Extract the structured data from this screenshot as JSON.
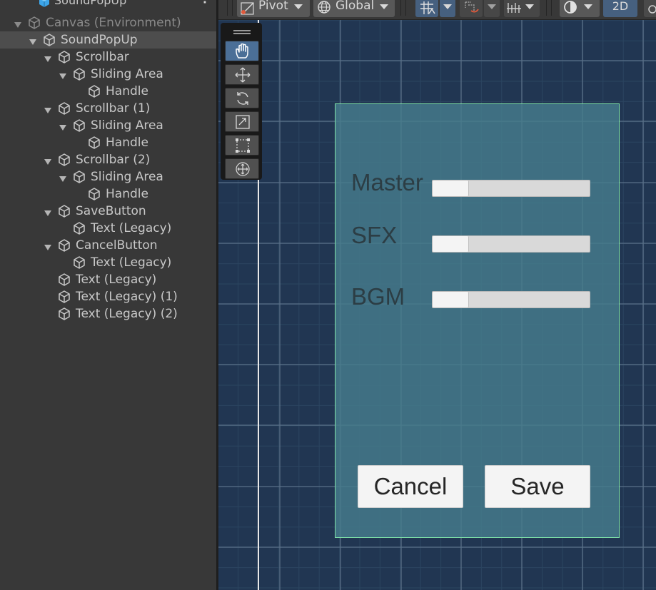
{
  "hierarchy": {
    "title": "SoundPopUp",
    "items": [
      {
        "label": "Canvas (Environment)",
        "depth": 0,
        "expanded": true,
        "dim": true
      },
      {
        "label": "SoundPopUp",
        "depth": 1,
        "expanded": true,
        "selected": true
      },
      {
        "label": "Scrollbar",
        "depth": 2,
        "expanded": true
      },
      {
        "label": "Sliding Area",
        "depth": 3,
        "expanded": true
      },
      {
        "label": "Handle",
        "depth": 4
      },
      {
        "label": "Scrollbar (1)",
        "depth": 2,
        "expanded": true
      },
      {
        "label": "Sliding Area",
        "depth": 3,
        "expanded": true
      },
      {
        "label": "Handle",
        "depth": 4
      },
      {
        "label": "Scrollbar (2)",
        "depth": 2,
        "expanded": true
      },
      {
        "label": "Sliding Area",
        "depth": 3,
        "expanded": true
      },
      {
        "label": "Handle",
        "depth": 4
      },
      {
        "label": "SaveButton",
        "depth": 2,
        "expanded": true
      },
      {
        "label": "Text (Legacy)",
        "depth": 3
      },
      {
        "label": "CancelButton",
        "depth": 2,
        "expanded": true
      },
      {
        "label": "Text (Legacy)",
        "depth": 3
      },
      {
        "label": "Text (Legacy)",
        "depth": 2
      },
      {
        "label": "Text (Legacy) (1)",
        "depth": 2
      },
      {
        "label": "Text (Legacy) (2)",
        "depth": 2
      }
    ]
  },
  "toolbar": {
    "pivot_label": "Pivot",
    "global_label": "Global",
    "mode_2d_label": "2D"
  },
  "popup": {
    "sliders": [
      {
        "label": "Master",
        "value": 0.23
      },
      {
        "label": "SFX",
        "value": 0.23
      },
      {
        "label": "BGM",
        "value": 0.23
      }
    ],
    "cancel_label": "Cancel",
    "save_label": "Save"
  },
  "colors": {
    "scene_bg": "#213652",
    "popup_fill": "#467d8c",
    "popup_border": "#7fe3a8",
    "active_tool": "#4b6f97"
  }
}
